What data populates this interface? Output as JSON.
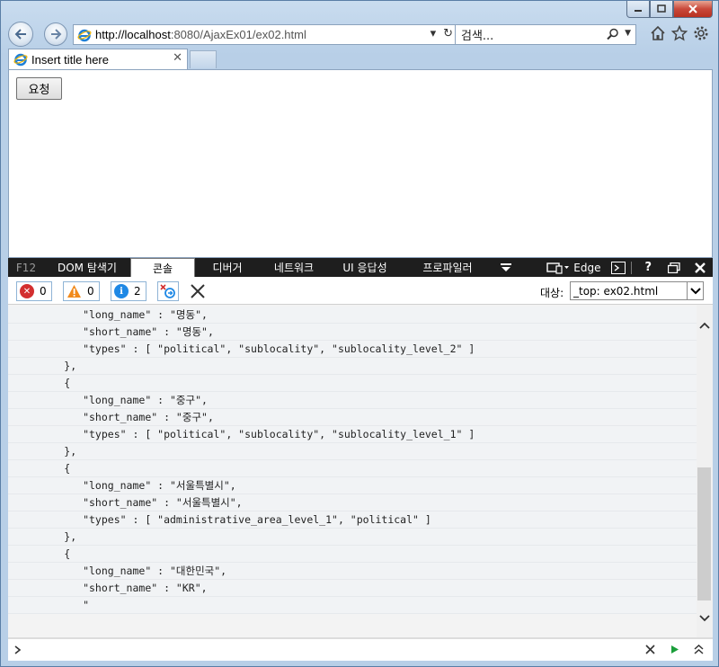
{
  "window": {
    "minimize_icon": "minimize-icon",
    "maximize_icon": "maximize-icon",
    "close_icon": "close-icon"
  },
  "browser": {
    "address_url": "http://localhost",
    "address_port_path": ":8080/AjaxEx01/ex02.html",
    "search_placeholder": "검색...",
    "tab_title": "Insert title here"
  },
  "page": {
    "request_button": "요청"
  },
  "devtools": {
    "tabs": [
      {
        "label": "F12"
      },
      {
        "label": "DOM 탐색기"
      },
      {
        "label": "콘솔"
      },
      {
        "label": "디버거"
      },
      {
        "label": "네트워크"
      },
      {
        "label": "UI 응답성"
      },
      {
        "label": "프로파일러"
      }
    ],
    "emulation_label": "Edge",
    "help_label": "?",
    "counts": {
      "errors": "0",
      "warnings": "0",
      "info": "2"
    },
    "target_label": "대상:",
    "target_value": "_top: ex02.html",
    "console_lines": [
      "            \"long_name\" : \"명동\",",
      "            \"short_name\" : \"명동\",",
      "            \"types\" : [ \"political\", \"sublocality\", \"sublocality_level_2\" ]",
      "         },",
      "         {",
      "            \"long_name\" : \"중구\",",
      "            \"short_name\" : \"중구\",",
      "            \"types\" : [ \"political\", \"sublocality\", \"sublocality_level_1\" ]",
      "         },",
      "         {",
      "            \"long_name\" : \"서울특별시\",",
      "            \"short_name\" : \"서울특별시\",",
      "            \"types\" : [ \"administrative_area_level_1\", \"political\" ]",
      "         },",
      "         {",
      "            \"long_name\" : \"대한민국\",",
      "            \"short_name\" : \"KR\",",
      "            \""
    ]
  }
}
